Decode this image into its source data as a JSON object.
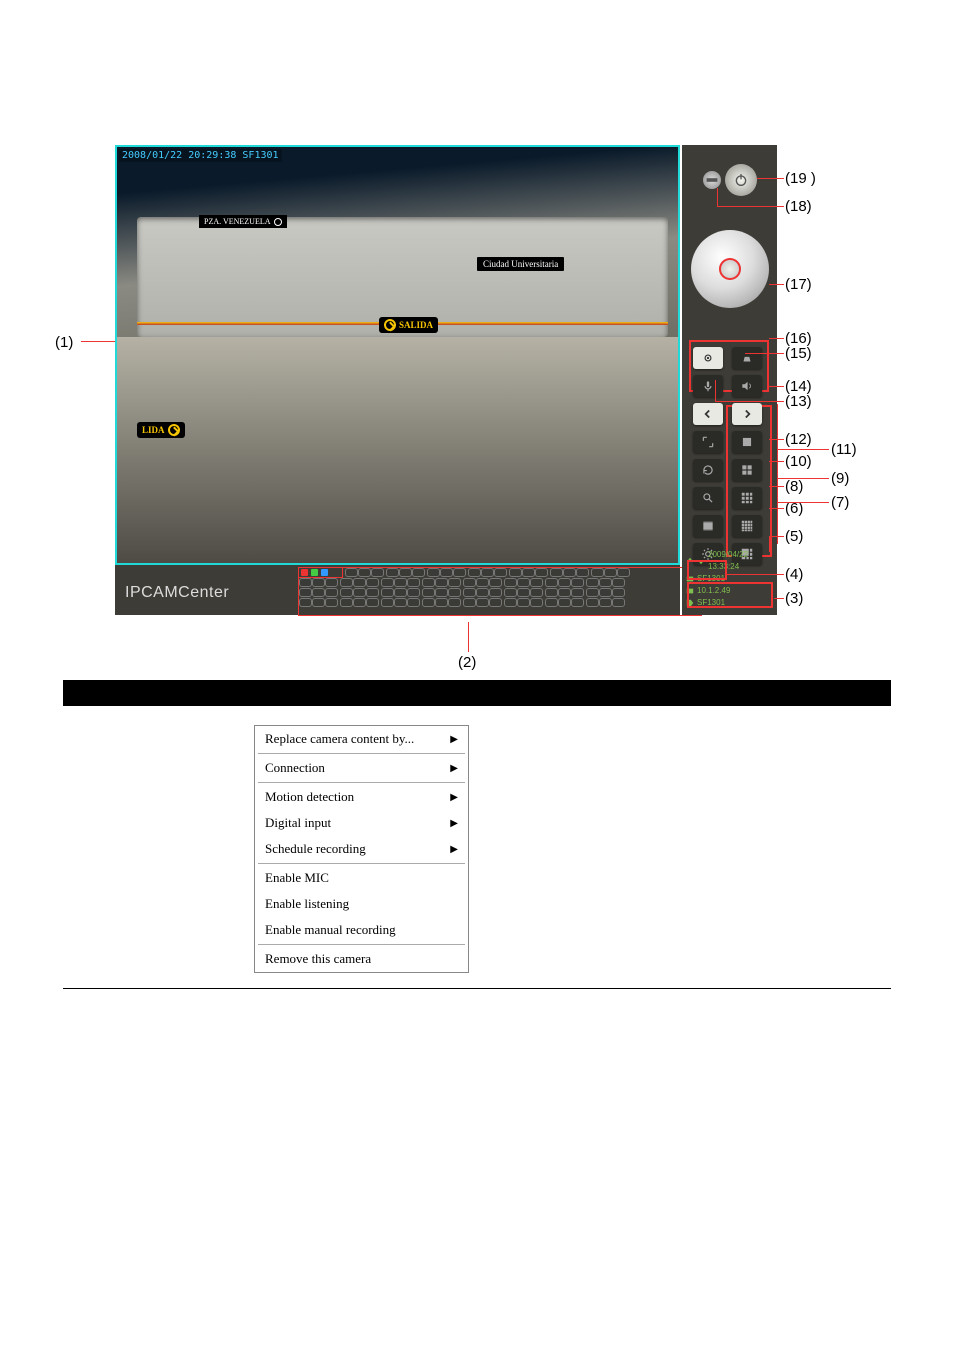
{
  "video": {
    "timestamp": "2008/01/22 20:29:38 SF1301",
    "sign_universitaria": "Ciudad Universitaria",
    "sign_salida": "SALIDA",
    "sign_pza": "PZA. VENEZUELA",
    "sign_lida": "LIDA"
  },
  "brand": "IPCAMCenter",
  "status": {
    "datetime": "2009/04/22 13:33:24",
    "model": "SF1301",
    "ip": "10.1.2.49",
    "camera": "SF1301"
  },
  "callouts": {
    "c1": "(1)",
    "c2": "(2)",
    "c3": "(3)",
    "c4": "(4)",
    "c5": "(5)",
    "c6": "(6)",
    "c7": "(7)",
    "c8": "(8)",
    "c9": "(9)",
    "c10": "(10)",
    "c11": "(11)",
    "c12": "(12)",
    "c13": "(13)",
    "c14": "(14)",
    "c15": "(15)",
    "c16": "(16)",
    "c17": "(17)",
    "c18": "(18)",
    "c19": "(19 )"
  },
  "menu": {
    "replace": "Replace camera content by...",
    "connection": "Connection",
    "motion": "Motion detection",
    "digital": "Digital input",
    "schedule": "Schedule recording",
    "mic": "Enable MIC",
    "listen": "Enable listening",
    "manual": "Enable manual recording",
    "remove": "Remove this camera"
  }
}
